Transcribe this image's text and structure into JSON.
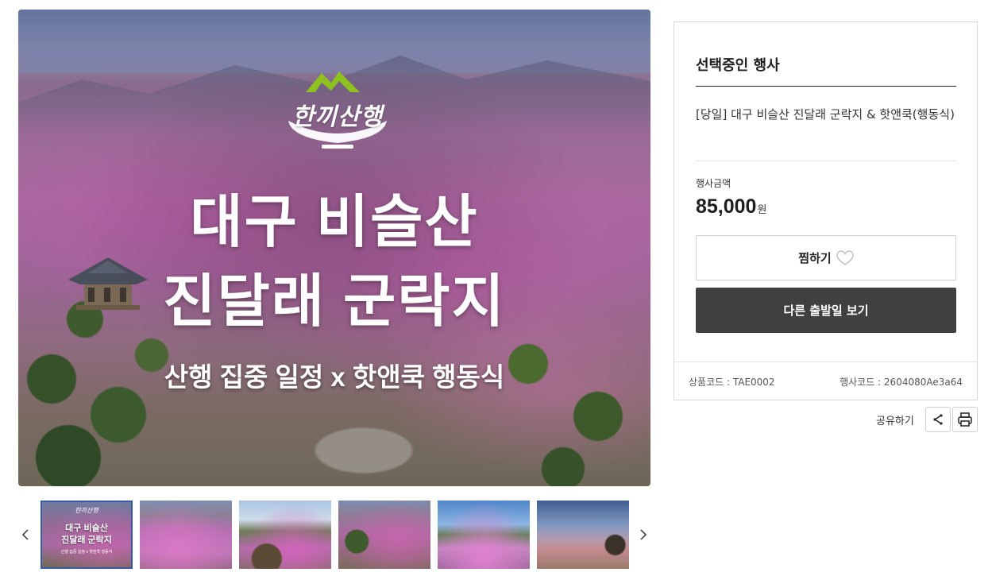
{
  "hero": {
    "logo_text": "한끼산행",
    "title_line1": "대구 비슬산",
    "title_line2": "진달래 군락지",
    "subtitle": "산행 집중 일정 x 핫앤쿡 행동식"
  },
  "thumbnails": {
    "first": {
      "logo_text": "한끼산행",
      "title_line1": "대구 비슬산",
      "title_line2": "진달래 군락지",
      "subtitle": "산행 집중 일정 x 핫앤쿡 행동식"
    },
    "count": 6,
    "selected_index": 0
  },
  "panel": {
    "heading": "선택중인 행사",
    "event_name": "[당일] 대구 비슬산 진달래 군락지 & 핫앤쿡(행동식)",
    "price_label": "행사금액",
    "price_value": "85,000",
    "price_unit": "원",
    "wish_label": "찜하기",
    "other_dates_label": "다른 출발일 보기",
    "product_code": "상품코드 : TAE0002",
    "event_code": "행사코드 : 2604080Ae3a64"
  },
  "share": {
    "label": "공유하기"
  },
  "icons": {
    "prev": "chevron-left-icon",
    "next": "chevron-right-icon",
    "wish": "heart-outline-icon",
    "share": "share-icon",
    "print": "printer-icon"
  },
  "colors": {
    "primary_button": "#404040",
    "thumbnail_selected_border": "#3a58a8",
    "panel_border": "#d6d6d6"
  }
}
